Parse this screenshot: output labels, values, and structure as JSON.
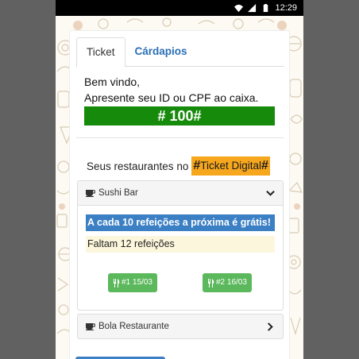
{
  "status_bar": {
    "time": "12:29"
  },
  "tabs": [
    {
      "label": "Ticket",
      "active": true
    },
    {
      "label": "Cárdapios",
      "active": false
    }
  ],
  "welcome": {
    "line1": "Bem vindo,",
    "line2": "Apresente seu ID ou CPF ao caixa."
  },
  "user_id": "# 100#",
  "restaurants_intro": "Seus restaurantes no",
  "brand_tag": {
    "hash_left": "#",
    "text": "Ticket Digital",
    "hash_right": "#"
  },
  "restaurants": [
    {
      "name": "Sushi Bar",
      "expanded": true,
      "promo": "A cada 10 refeições a próxima é grátis!",
      "remaining": "Faltam 12 refeições",
      "meals": [
        {
          "label": "#1 15/03"
        },
        {
          "label": "#2 16/03"
        }
      ]
    },
    {
      "name": "Bola Restaurante",
      "expanded": false
    }
  ],
  "colors": {
    "id_box": "#168a0b",
    "brand_tag": "#f6a71e",
    "promo": "#3b7fc4",
    "remaining": "#fcf7dc",
    "meal_button": "#5cb85c",
    "tab_link": "#2a6fb5"
  }
}
